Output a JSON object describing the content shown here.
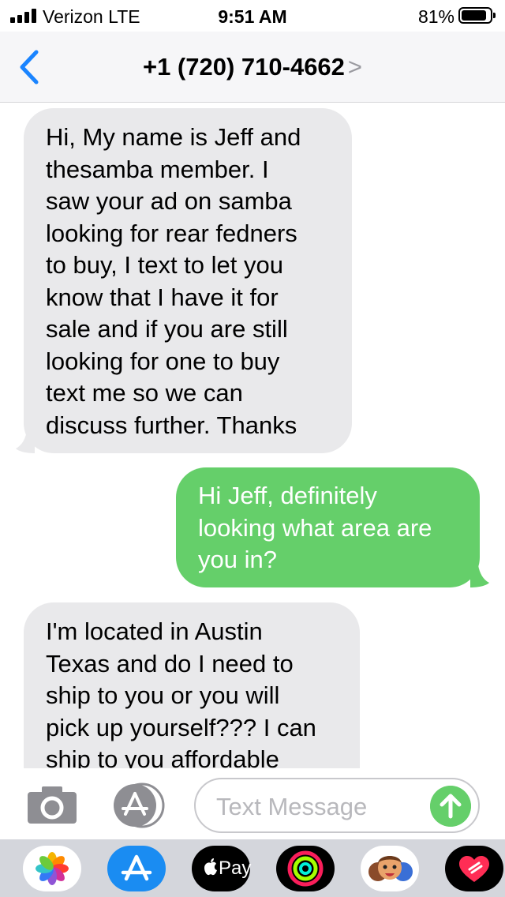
{
  "status_bar": {
    "carrier": "Verizon  LTE",
    "time": "9:51 AM",
    "battery_percent": "81%"
  },
  "nav": {
    "contact": "+1 (720) 710-4662",
    "chevron": ">"
  },
  "messages": [
    {
      "direction": "received",
      "lines": [
        "Hi, My name is Jeff and",
        "thesamba member. I",
        "saw your ad on samba",
        "looking for rear fedners",
        "to buy, I text to let you",
        "know that I have it for",
        "sale and if you are still",
        "looking for one to buy",
        "text me so we can",
        "discuss further. Thanks"
      ]
    },
    {
      "direction": "sent",
      "lines": [
        "Hi Jeff, definitely",
        "looking what area are",
        "you in?"
      ]
    },
    {
      "direction": "received",
      "lines": [
        "I'm located in Austin",
        "Texas and do I need to",
        "ship to you or you will",
        "pick up yourself??? I can",
        "ship to you affordable"
      ]
    }
  ],
  "input": {
    "placeholder": "Text Message"
  },
  "app_drawer": {
    "apple_pay_label": "Pay",
    "items": [
      "photos-app-icon",
      "app-store-app-icon",
      "apple-pay-app-icon",
      "activity-app-icon",
      "memoji-app-icon",
      "digital-touch-app-icon"
    ]
  },
  "colors": {
    "sent_bubble": "#65cf6a",
    "received_bubble": "#e9e9eb",
    "ios_blue": "#1a84ff",
    "drawer_bg": "#d4d6dc"
  }
}
